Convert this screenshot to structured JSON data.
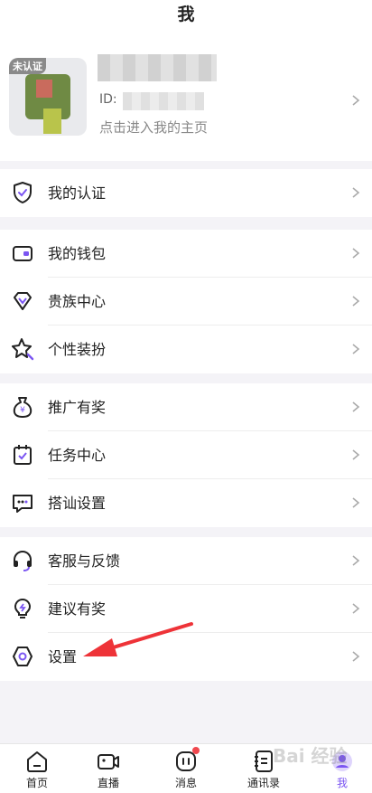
{
  "header": {
    "title": "我"
  },
  "profile": {
    "badge": "未认证",
    "id_prefix": "ID:",
    "home_link": "点击进入我的主页"
  },
  "menu": {
    "verify": "我的认证",
    "wallet": "我的钱包",
    "noble": "贵族中心",
    "dressup": "个性装扮",
    "promote": "推广有奖",
    "tasks": "任务中心",
    "chat_settings": "搭讪设置",
    "support": "客服与反馈",
    "suggest": "建议有奖",
    "settings": "设置"
  },
  "tabbar": {
    "home": "首页",
    "live": "直播",
    "messages": "消息",
    "contacts": "通讯录",
    "me": "我"
  },
  "colors": {
    "accent": "#7b55f2",
    "arrow": "#ee3338",
    "badge_dot": "#f0484e"
  }
}
